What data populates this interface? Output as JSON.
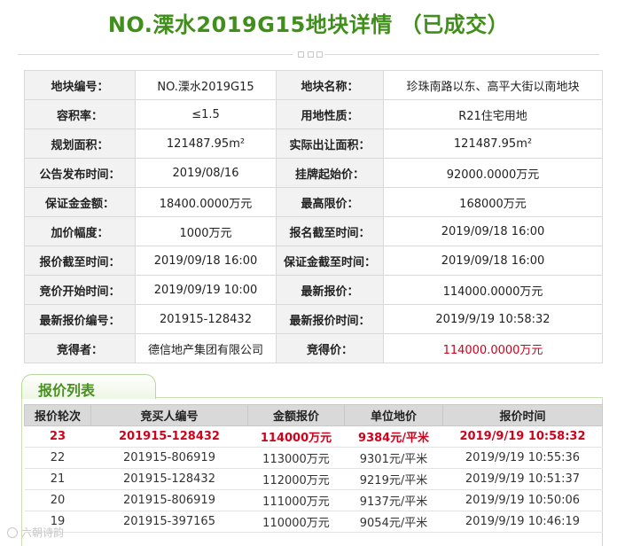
{
  "header": {
    "title": "NO.溧水2019G15地块详情 （已成交）"
  },
  "detail_rows": [
    [
      {
        "label": "地块编号：",
        "value": "NO.溧水2019G15"
      },
      {
        "label": "地块名称：",
        "value": "珍珠南路以东、高平大街以南地块"
      }
    ],
    [
      {
        "label": "容积率：",
        "value": "≤1.5"
      },
      {
        "label": "用地性质：",
        "value": "R21住宅用地"
      }
    ],
    [
      {
        "label": "规划面积：",
        "value": "121487.95m²"
      },
      {
        "label": "实际出让面积：",
        "value": "121487.95m²"
      }
    ],
    [
      {
        "label": "公告发布时间：",
        "value": "2019/08/16"
      },
      {
        "label": "挂牌起始价：",
        "value": "92000.0000万元"
      }
    ],
    [
      {
        "label": "保证金金额：",
        "value": "18400.0000万元"
      },
      {
        "label": "最高限价：",
        "value": "168000万元"
      }
    ],
    [
      {
        "label": "加价幅度：",
        "value": "1000万元"
      },
      {
        "label": "报名截至时间：",
        "value": "2019/09/18 16:00"
      }
    ],
    [
      {
        "label": "报价截至时间：",
        "value": "2019/09/18 16:00"
      },
      {
        "label": "保证金截至时间：",
        "value": "2019/09/18 16:00"
      }
    ],
    [
      {
        "label": "竞价开始时间：",
        "value": "2019/09/19 10:00"
      },
      {
        "label": "最新报价：",
        "value": "114000.0000万元"
      }
    ],
    [
      {
        "label": "最新报价编号：",
        "value": "201915-128432"
      },
      {
        "label": "最新报价时间：",
        "value": "2019/9/19 10:58:32"
      }
    ],
    [
      {
        "label": "竞得者：",
        "value": "德信地产集团有限公司"
      },
      {
        "label": "竞得价：",
        "value": "114000.0000万元"
      }
    ]
  ],
  "bid_section": {
    "tab_label": "报价列表",
    "columns": [
      "报价轮次",
      "竞买人编号",
      "金额报价",
      "单位地价",
      "报价时间"
    ],
    "rows": [
      [
        "23",
        "201915-128432",
        "114000万元",
        "9384元/平米",
        "2019/9/19 10:58:32"
      ],
      [
        "22",
        "201915-806919",
        "113000万元",
        "9301元/平米",
        "2019/9/19 10:55:36"
      ],
      [
        "21",
        "201915-128432",
        "112000万元",
        "9219元/平米",
        "2019/9/19 10:51:37"
      ],
      [
        "20",
        "201915-806919",
        "111000万元",
        "9137元/平米",
        "2019/9/19 10:50:06"
      ],
      [
        "19",
        "201915-397165",
        "110000万元",
        "9054元/平米",
        "2019/9/19 10:46:19"
      ]
    ]
  },
  "watermark": {
    "text": "六朝诗韵"
  },
  "colors": {
    "title_green": "#3f8f1a",
    "highlight_red": "#d0021b",
    "label_bg": "#f2f2f2",
    "header_bg": "#d9d9d9"
  }
}
